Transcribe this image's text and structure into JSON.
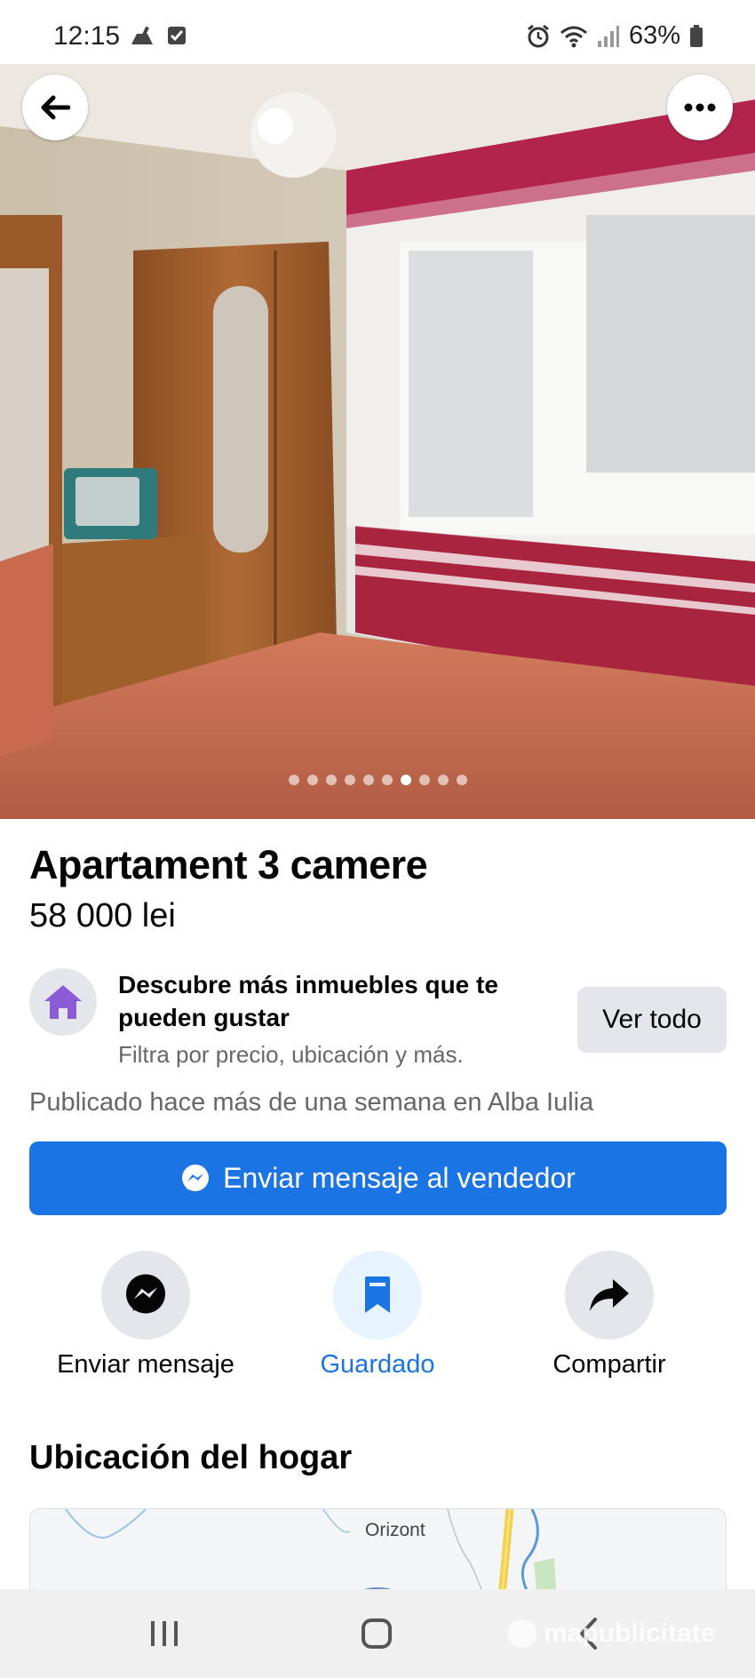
{
  "status_bar": {
    "time": "12:15",
    "battery": "63%"
  },
  "gallery": {
    "image_count": 10,
    "active_index": 6
  },
  "listing": {
    "title": "Apartament 3 camere",
    "price": "58 000 lei"
  },
  "promo": {
    "title": "Descubre más inmuebles que te pueden gustar",
    "subtitle": "Filtra por precio, ubicación y más.",
    "button_label": "Ver todo"
  },
  "published_text": "Publicado hace más de una semana en Alba Iulia",
  "message_seller_label": "Enviar mensaje al vendedor",
  "actions": {
    "send_message": "Enviar mensaje",
    "saved": "Guardado",
    "share": "Compartir"
  },
  "location": {
    "section_title": "Ubicación del hogar",
    "map_label": "Orizont"
  },
  "watermark": "mapublicitate",
  "colors": {
    "accent": "#1b74e4",
    "saved_bg": "#e7f3ff",
    "button_gray": "#e4e6eb",
    "secondary_text": "#65676b"
  }
}
